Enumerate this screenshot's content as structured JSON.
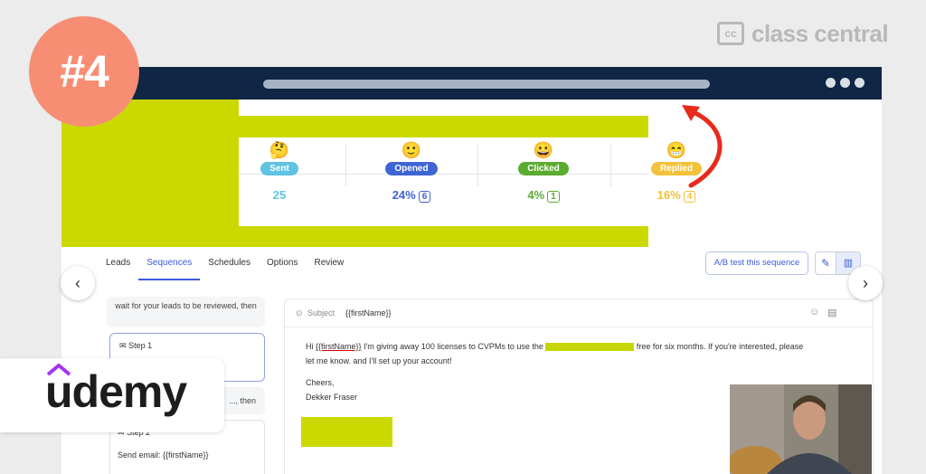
{
  "badge": {
    "text": "#4",
    "color": "#f78e74"
  },
  "class_central": {
    "icon_text": "cc",
    "text": "class central"
  },
  "udemy": {
    "text": "udemy"
  },
  "stats": [
    {
      "emoji": "🤔",
      "label": "Sent",
      "value": "25",
      "count": "",
      "color": "#5fc3e4"
    },
    {
      "emoji": "🙂",
      "label": "Opened",
      "value": "24%",
      "count": "6",
      "color": "#3f64d4"
    },
    {
      "emoji": "😀",
      "label": "Clicked",
      "value": "4%",
      "count": "1",
      "color": "#5aab2f"
    },
    {
      "emoji": "😁",
      "label": "Replied",
      "value": "16%",
      "count": "4",
      "color": "#f2c23a"
    }
  ],
  "tabs": [
    "Leads",
    "Sequences",
    "Schedules",
    "Options",
    "Review"
  ],
  "active_tab": "Sequences",
  "ab_button": "A/B test this sequence",
  "left_panel": {
    "wait_text": "wait for your leads to be reviewed, then",
    "step1_label": "Step 1",
    "wait2_text": "..., then",
    "step2_label": "Step 2",
    "step2_body": "Send email: {{firstName}}"
  },
  "editor": {
    "subject_label": "Subject",
    "subject_value": "{{firstName}}",
    "body_part1": "Hi",
    "body_var": "{{firstName}}",
    "body_part2": "I'm giving away 100 licenses to CVPMs to use the",
    "body_part3": "free for six months. If you're interested, please let me know. and I'll set up your account!",
    "sign_off": "Cheers,",
    "sender": "Dekker Fraser"
  },
  "colors": {
    "lime": "#cbd900",
    "navy": "#0f2644",
    "arrow_red": "#e8291c",
    "accent": "#3a5bd9"
  }
}
